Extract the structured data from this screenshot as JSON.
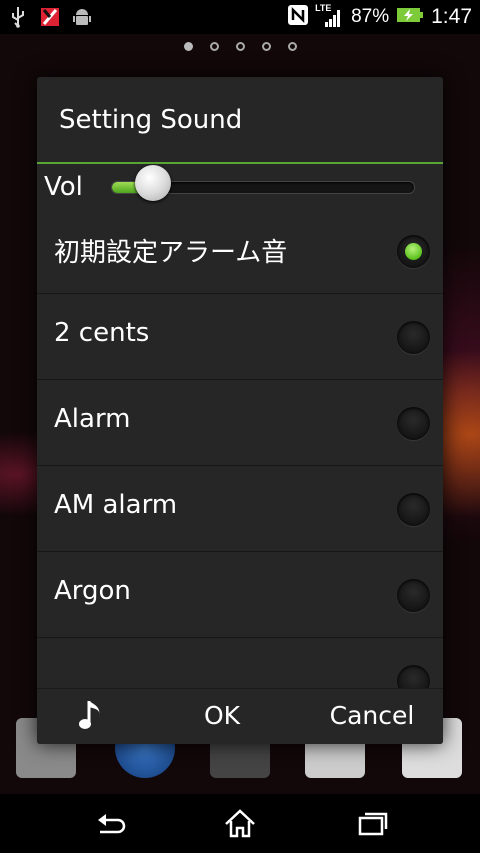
{
  "status_bar": {
    "lte": "LTE",
    "battery": "87%",
    "time": "1:47",
    "icons": [
      "usb-icon",
      "app-notification-icon",
      "android-debug-icon",
      "nfc-icon",
      "signal-icon",
      "battery-charging-icon"
    ]
  },
  "home": {
    "page_count": 5,
    "active_page": 1
  },
  "dialog": {
    "title": "Setting Sound",
    "vol_label": "Vol",
    "volume_fraction": 0.12,
    "items": [
      {
        "label": "初期設定アラーム音",
        "selected": true
      },
      {
        "label": "2 cents",
        "selected": false
      },
      {
        "label": "Alarm",
        "selected": false
      },
      {
        "label": "AM alarm",
        "selected": false
      },
      {
        "label": "Argon",
        "selected": false
      },
      {
        "label": "",
        "selected": false
      }
    ],
    "buttons": {
      "note_icon": "music-note-icon",
      "ok": "OK",
      "cancel": "Cancel"
    }
  },
  "colors": {
    "accent": "#5aa634",
    "dialog_bg": "#262626"
  }
}
